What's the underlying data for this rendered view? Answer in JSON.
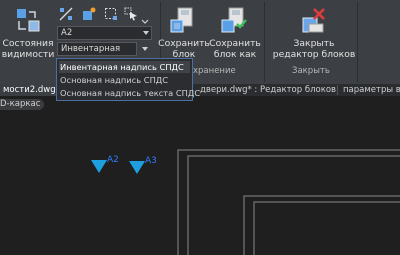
{
  "ribbon": {
    "visibility_states_label": "Состояния\nвидимости",
    "combo_top_value": "A2",
    "combo_bottom_value": "Инвентарная н...",
    "save_block_label": "Сохранить\nблок",
    "save_block_as_label": "Сохранить\nблок как",
    "close_editor_label": "Закрыть\nредактор блоков",
    "panel_save_title": "хранение",
    "panel_close_title": "Закрыть"
  },
  "dropdown": {
    "items": [
      "Инвентарная надпись СПДС",
      "Основная надпись СПДС",
      "Основная надпись текста СПДС"
    ],
    "selected_index": 0
  },
  "tabs": [
    {
      "label": "мости2.dwg*",
      "active": true
    },
    {
      "label": "двери.dwg* : Редактор блоков",
      "active": false
    },
    {
      "label": "параметры вне",
      "active": false
    }
  ],
  "viewport": {
    "style_label": "D-каркас",
    "markers": [
      "A2",
      "A3"
    ]
  },
  "colors": {
    "ribbon_bg": "#3c3f44",
    "canvas_bg": "#1f1f1f",
    "marker": "#1e9fe0",
    "marker_label": "#2f7bff"
  }
}
